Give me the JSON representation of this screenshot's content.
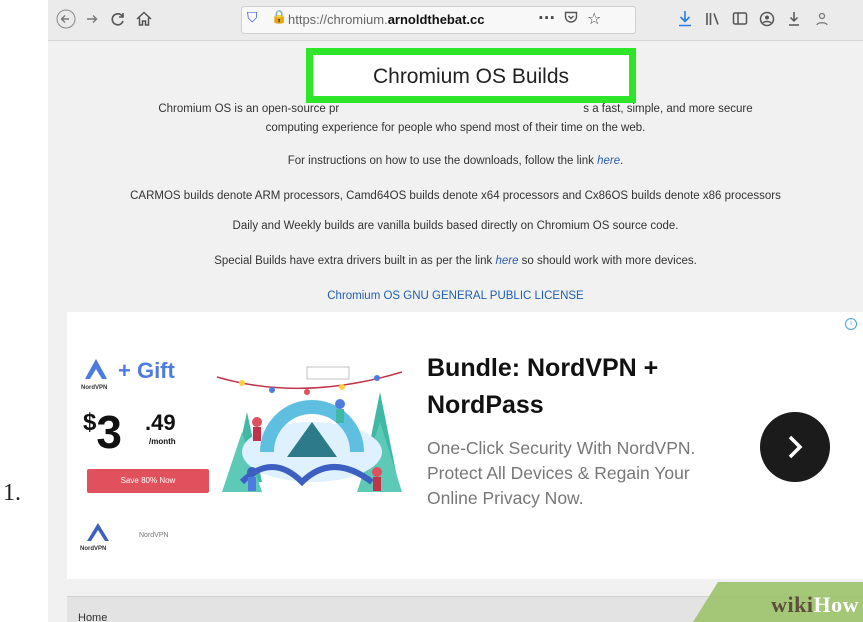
{
  "step_number": "1.",
  "browser": {
    "url_prefix": "https://chromium.",
    "url_domain": "arnoldthebat.cc",
    "nav_icons": [
      "back-icon",
      "forward-icon",
      "reload-icon",
      "home-icon"
    ],
    "toolbar_icons": [
      "download-icon",
      "library-icon",
      "sidebar-icon",
      "account-icon",
      "extension-icon",
      "extension-icon"
    ]
  },
  "page": {
    "title": "Chromium OS Builds",
    "intro_line1_a": "Chromium OS is an open-source pr",
    "intro_line1_b": "s a fast, simple, and more secure",
    "intro_line2": "computing experience for people who spend most of their time on the web.",
    "instructions_text": "For instructions on how to use the downloads, follow the link ",
    "instructions_link": "here",
    "instructions_end": ".",
    "builds_text": "CARMOS builds denote ARM processors, Camd64OS builds denote x64 processors and Cx86OS builds denote x86 processors",
    "vanilla_text": "Daily and Weekly builds are vanilla builds based directly on Chromium OS source code.",
    "special_text_a": "Special Builds have extra drivers built in as per the link ",
    "special_link": "here",
    "special_text_b": " so should work with more devices.",
    "license_link": "Chromium OS GNU GENERAL PUBLIC LICENSE"
  },
  "ad": {
    "brand_small": "NordVPN",
    "gift": "+ Gift",
    "price_dollar": "$",
    "price_main": "3",
    "price_cents": ".49",
    "price_period": "/month",
    "save_button": "Save 80% Now",
    "advertiser": "NordVPN",
    "headline": "Bundle: NordVPN + NordPass",
    "subtext": "One-Click Security With NordVPN. Protect All Devices & Regain Your Online Privacy Now.",
    "adchoices_icon": "adchoices-icon"
  },
  "bottom_bar": {
    "home": "Home"
  },
  "watermark": {
    "wiki": "wiki",
    "how": "How"
  },
  "colors": {
    "highlight": "#2fe52a",
    "link": "#2a5db0",
    "download_icon": "#2a7de1",
    "save_button": "#e0505d",
    "arrow_button": "#1b1b1b",
    "nord_blue": "#4d7be0"
  }
}
